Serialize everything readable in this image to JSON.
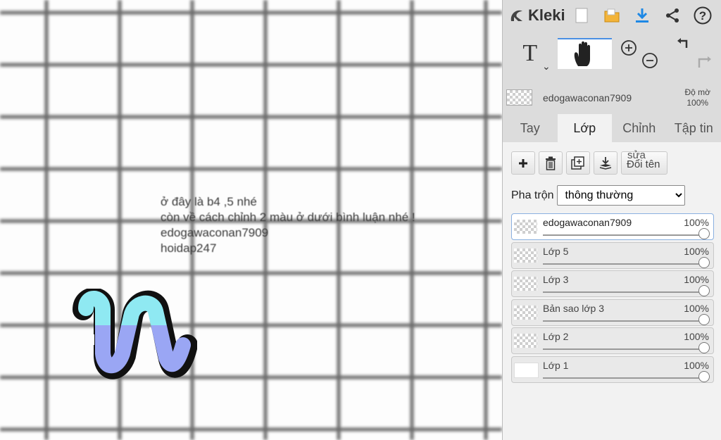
{
  "canvas": {
    "text_lines": [
      "ở đây là b4 ,5 nhé",
      "còn về cách chỉnh 2 màu ở dưới bình luận nhé !",
      "edogawaconan7909",
      "hoidap247"
    ],
    "colors": {
      "grid": "#6a6a6a",
      "squiggle_top": "#8fe9f2",
      "squiggle_bottom": "#9aa6f4"
    }
  },
  "app": {
    "logo_text": "Kleki",
    "top_icons": [
      "new-file-icon",
      "open-folder-icon",
      "download-icon",
      "share-icon",
      "help-icon"
    ],
    "accent_color": "#1e88e5"
  },
  "tools": {
    "text_tool": "T",
    "active_tool": "hand-tool"
  },
  "layer_info": {
    "name": "edogawaconan7909",
    "opacity_label": "Độ mờ",
    "opacity_value": "100%"
  },
  "tabs": [
    {
      "label": "Tay",
      "active": false
    },
    {
      "label": "Lớp",
      "active": true
    },
    {
      "label": "Chỉnh",
      "active": false
    },
    {
      "label": "Tập tin",
      "active": false
    }
  ],
  "layer_buttons": {
    "rename_top": "sửa",
    "rename_label": "Đổi tên"
  },
  "blend": {
    "label": "Pha trộn",
    "value": "thông thường"
  },
  "layers": [
    {
      "name": "edogawaconan7909",
      "opacity": "100%",
      "opacity_level": 1.0,
      "selected": true
    },
    {
      "name": "Lớp 5",
      "opacity": "100%",
      "opacity_level": 1.0,
      "selected": false
    },
    {
      "name": "Lớp 3",
      "opacity": "100%",
      "opacity_level": 1.0,
      "selected": false
    },
    {
      "name": "Bản sao lớp 3",
      "opacity": "100%",
      "opacity_level": 1.0,
      "selected": false
    },
    {
      "name": "Lớp 2",
      "opacity": "100%",
      "opacity_level": 1.0,
      "selected": false
    },
    {
      "name": "Lớp 1",
      "opacity": "100%",
      "opacity_level": 1.0,
      "selected": false
    }
  ]
}
